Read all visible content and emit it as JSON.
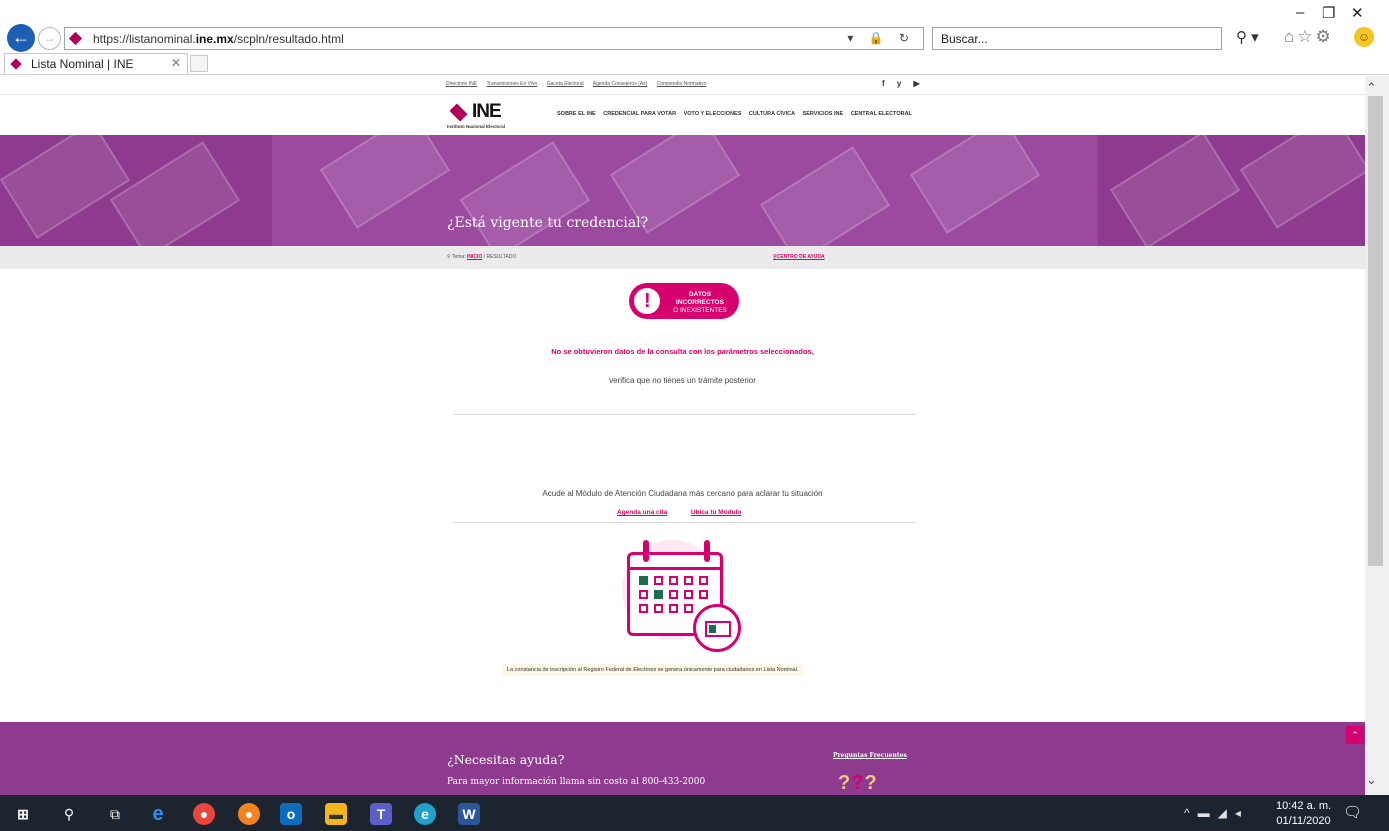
{
  "browser": {
    "url_prefix": "https://listanominal.",
    "url_domain": "ine.mx",
    "url_path": "/scpln/resultado.html",
    "search_placeholder": "Buscar...",
    "tab_title": "Lista Nominal | INE"
  },
  "util_bar": {
    "links": [
      "Directorio INE",
      "Transmisiones En Vivo",
      "Gaceta Electoral",
      "Agenda Consejeros (As)",
      "Compendio Normativo"
    ],
    "social": "f  y  ▶"
  },
  "header": {
    "logo_word": "INE",
    "logo_sub": "Instituto Nacional Electoral",
    "nav": [
      "SOBRE EL INE",
      "CREDENCIAL PARA VOTAR",
      "VOTO Y ELECCIONES",
      "CULTURA CÍVICA",
      "SERVICIOS INE",
      "CENTRAL ELECTORAL"
    ]
  },
  "hero": {
    "title": "¿Está vigente tu credencial?"
  },
  "breadcrumb": {
    "prefix": "Tema:",
    "home": "INICIO",
    "current": "/ RESULTADO",
    "help": "CENTRO DE AYUDA"
  },
  "status": {
    "line1": "DATOS INCORRECTOS",
    "line2": "O INEXISTENTES"
  },
  "messages": {
    "main": "No se obtuvieron datos de la consulta con los parámetros seleccionados,",
    "sub": "verifica que no tienes un trámite posterior",
    "module": "Acude al Módulo de Atención Ciudadana más cercano para aclarar tu situación",
    "link_agenda": "Agenda una cita",
    "link_module": "Ubica tu Módulo",
    "note": "La constancia de inscripción al Registro Federal de Electores se genera únicamente para ciudadanos en Lista Nominal."
  },
  "footer": {
    "title": "¿Necesitas ayuda?",
    "phone": "Para mayor información llama sin costo al 800-433-2000",
    "faq": "Preguntas Frecuentes"
  },
  "taskbar": {
    "time": "10:42 a. m.",
    "date": "01/11/2020"
  },
  "colors": {
    "brand": "#d6006f",
    "purple": "#8e3a8e",
    "green": "#1e6b4f"
  }
}
